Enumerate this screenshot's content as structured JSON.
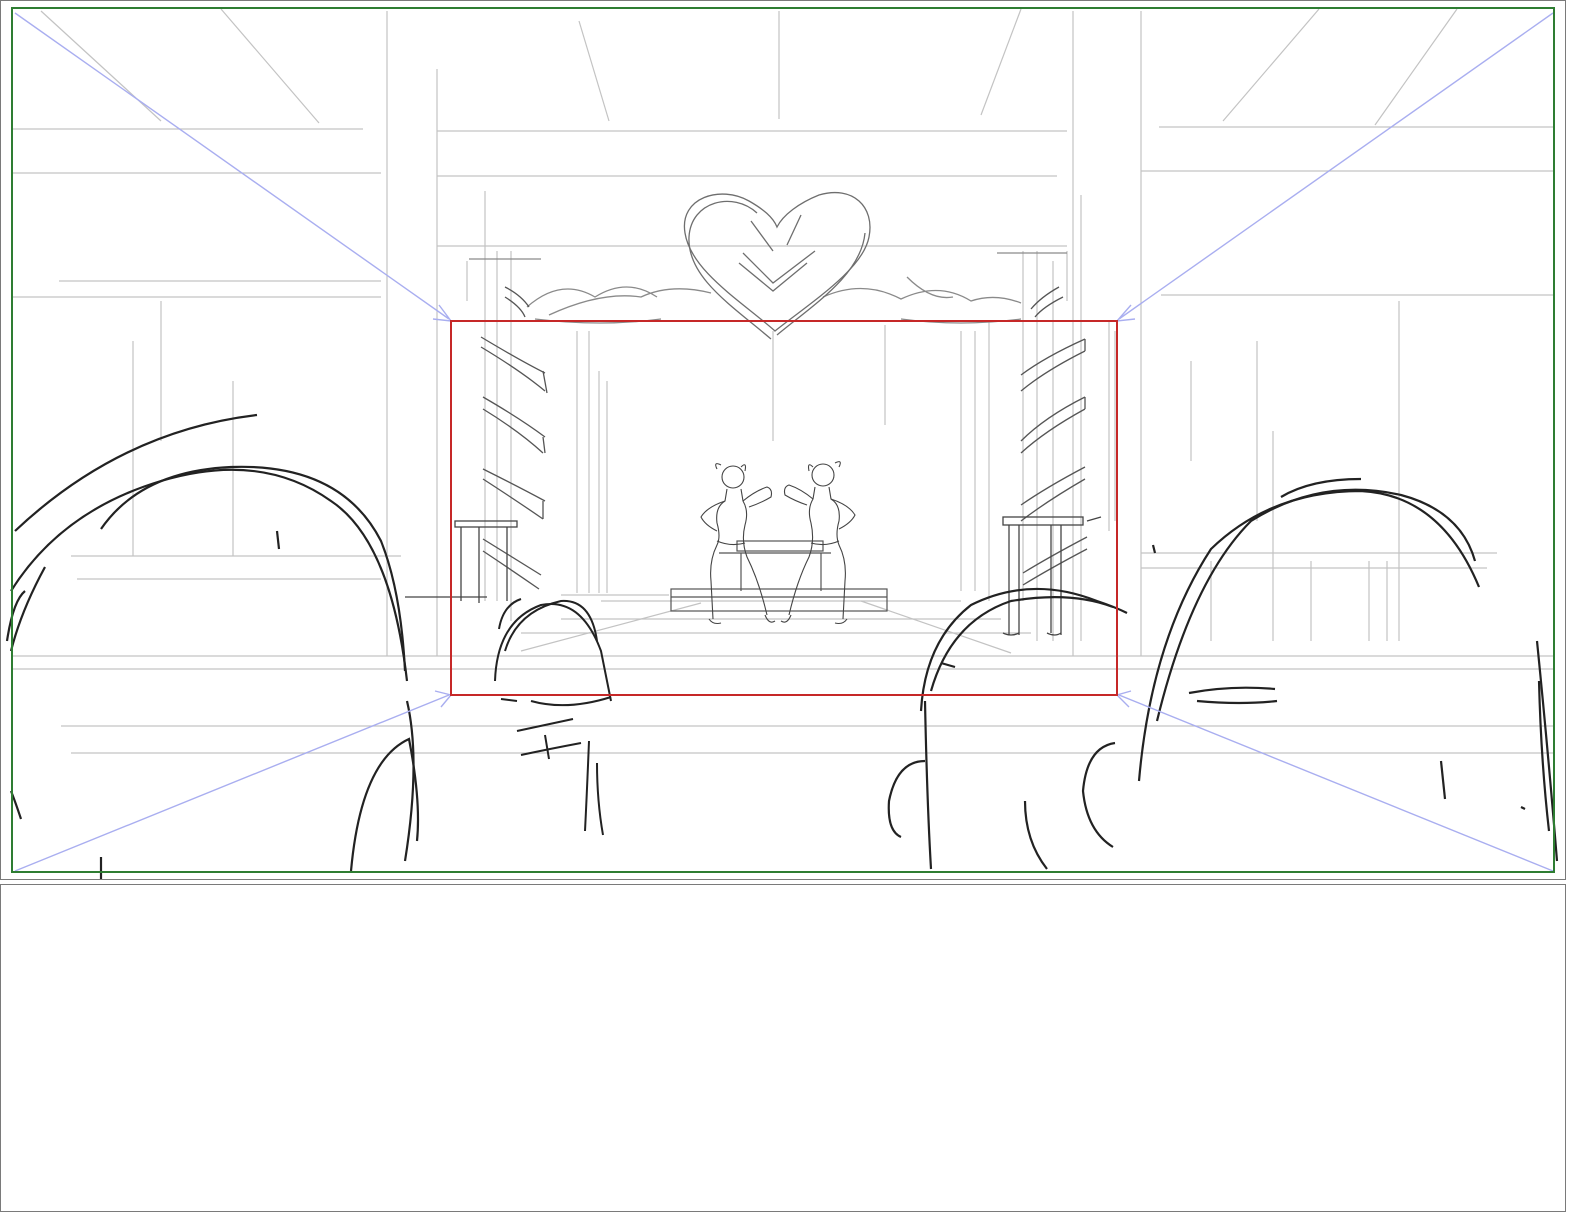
{
  "storyboard": {
    "panels": [
      {
        "kind": "sketch",
        "subject": "stage-with-two-dancers-and-audience-heads",
        "frame_colors": {
          "camera_start": "#2e7d32",
          "camera_end": "#c62828",
          "zoom_arrows": "#a9aef0",
          "sketch_light": "#b9b9b9",
          "sketch_dark": "#2b2b2b"
        },
        "camera_move": "zoom-in"
      },
      {
        "kind": "empty"
      }
    ]
  }
}
